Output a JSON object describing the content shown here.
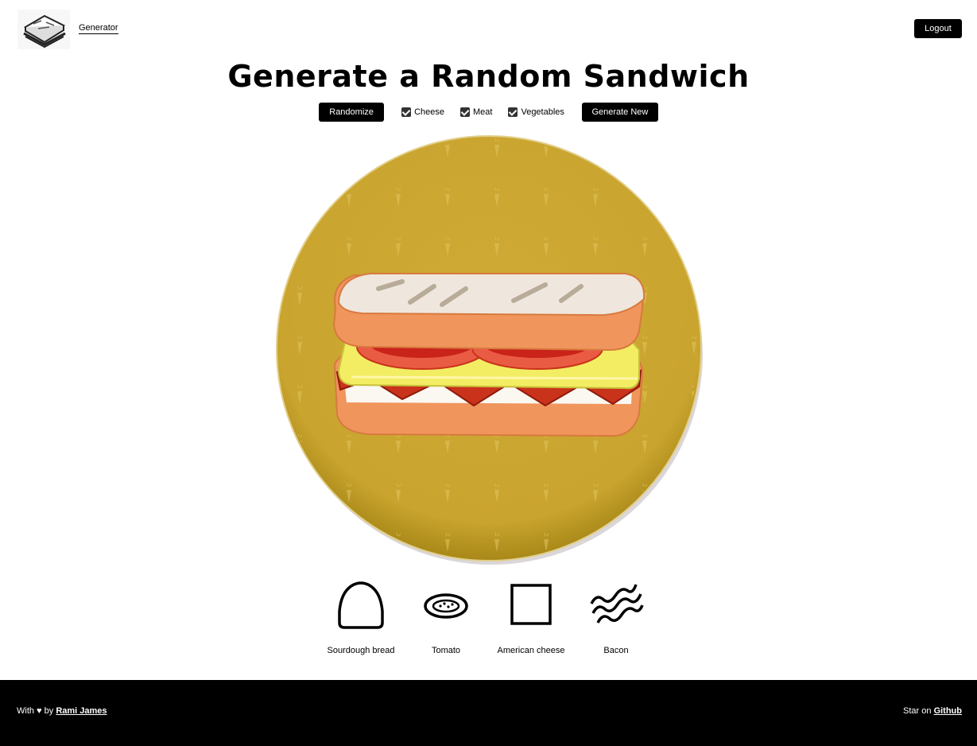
{
  "header": {
    "logo_icon": "sandwich-logo-icon",
    "nav": {
      "generator_label": "Generator"
    },
    "logout_label": "Logout"
  },
  "page_title": "Generate a Random Sandwich",
  "controls": {
    "randomize_label": "Randomize",
    "filters": [
      {
        "label": "Cheese",
        "checked": true
      },
      {
        "label": "Meat",
        "checked": true
      },
      {
        "label": "Vegetables",
        "checked": true
      }
    ],
    "generate_label": "Generate New"
  },
  "plate": {
    "icon": "sandwich-plate-image",
    "color": "#cda832",
    "pattern_icon": "carrot-icon"
  },
  "ingredients": [
    {
      "label": "Sourdough bread",
      "icon": "bread-icon"
    },
    {
      "label": "Tomato",
      "icon": "tomato-icon"
    },
    {
      "label": "American cheese",
      "icon": "cheese-icon"
    },
    {
      "label": "Bacon",
      "icon": "bacon-icon"
    }
  ],
  "footer": {
    "left_prefix": "With ♥ by",
    "author_link": "Rami James",
    "right_prefix": "Star on",
    "github_link": "Github"
  }
}
